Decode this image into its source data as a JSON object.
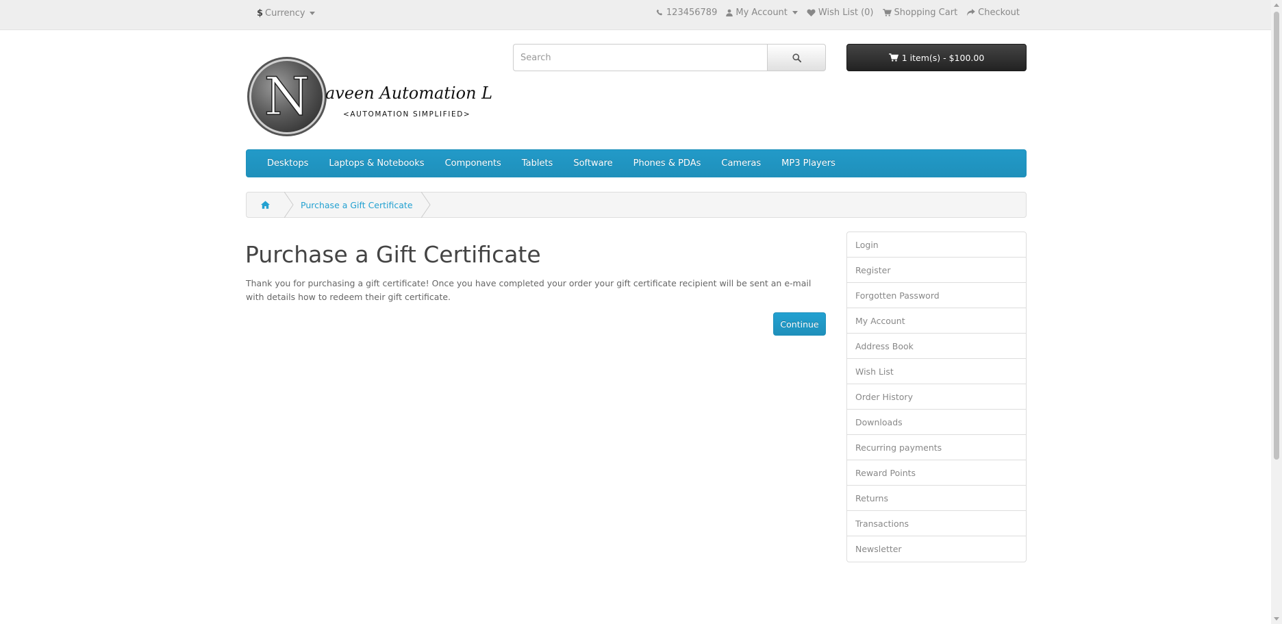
{
  "top_bar": {
    "currency_symbol": "$",
    "currency_label": "Currency",
    "phone": "123456789",
    "my_account": "My Account",
    "wish_list": "Wish List (0)",
    "shopping_cart": "Shopping Cart",
    "checkout": "Checkout"
  },
  "logo": {
    "initial": "N",
    "name": "aveen Automation Labs",
    "tagline": "<AUTOMATION SIMPLIFIED>"
  },
  "search": {
    "placeholder": "Search"
  },
  "cart": {
    "label": "1 item(s) - $100.00"
  },
  "menu": {
    "items": [
      "Desktops",
      "Laptops & Notebooks",
      "Components",
      "Tablets",
      "Software",
      "Phones & PDAs",
      "Cameras",
      "MP3 Players"
    ]
  },
  "breadcrumb": {
    "current": "Purchase a Gift Certificate"
  },
  "main": {
    "title": "Purchase a Gift Certificate",
    "text": "Thank you for purchasing a gift certificate! Once you have completed your order your gift certificate recipient will be sent an e-mail with details how to redeem their gift certificate.",
    "continue_label": "Continue"
  },
  "account_menu": {
    "items": [
      "Login",
      "Register",
      "Forgotten Password",
      "My Account",
      "Address Book",
      "Wish List",
      "Order History",
      "Downloads",
      "Recurring payments",
      "Reward Points",
      "Returns",
      "Transactions",
      "Newsletter"
    ]
  },
  "colors": {
    "accent": "#229ac8",
    "link": "#23a1d1",
    "cart_button": "#333333",
    "top_bar": "#eeeeee"
  }
}
